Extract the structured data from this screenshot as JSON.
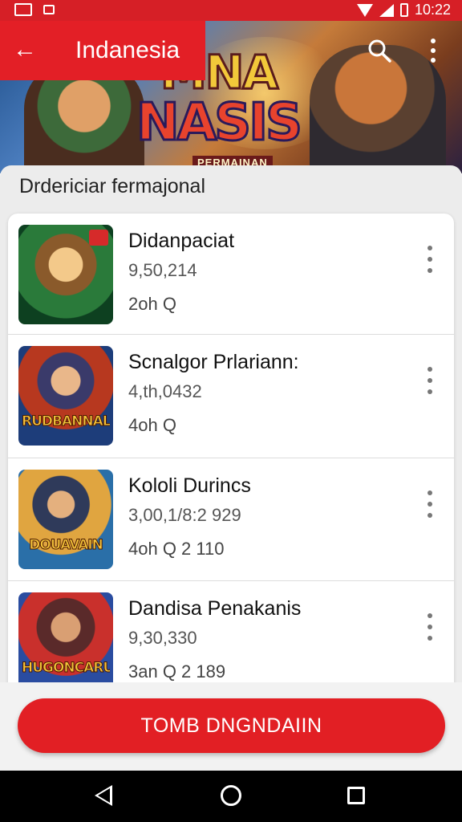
{
  "status_bar": {
    "time": "10:22",
    "icons": [
      "notification-icon",
      "sim-icon",
      "wifi-icon",
      "signal-icon",
      "battery-icon"
    ]
  },
  "banner": {
    "logo_line1": "MNA",
    "logo_line2": "NASIS",
    "logo_tag": "PERMAINAN"
  },
  "app_bar": {
    "back_glyph": "←",
    "title": "Indanesia"
  },
  "section": {
    "title": "Drdericiar fermajonal"
  },
  "games": [
    {
      "name": "Didanpaciat",
      "count": "9,50,214",
      "meta": "2oh Q",
      "thumb_label": ""
    },
    {
      "name": "Scnalgor Prlariann:",
      "count": "4,th,0432",
      "meta": "4oh Q",
      "thumb_label": "RUDBANNAL"
    },
    {
      "name": "Kololi Durincs",
      "count": "3,00,1/8:2 929",
      "meta": "4oh Q 2 110",
      "thumb_label": "DOUAVAIN"
    },
    {
      "name": "Dandisa Penakanis",
      "count": "9,30,330",
      "meta": "3an Q 2 189",
      "thumb_label": "HUGONCARUIS"
    }
  ],
  "cta": {
    "label": "TOMB DNGNDAIIN"
  },
  "colors": {
    "accent": "#e31f26",
    "panel": "#ececec",
    "nav": "#000000"
  }
}
